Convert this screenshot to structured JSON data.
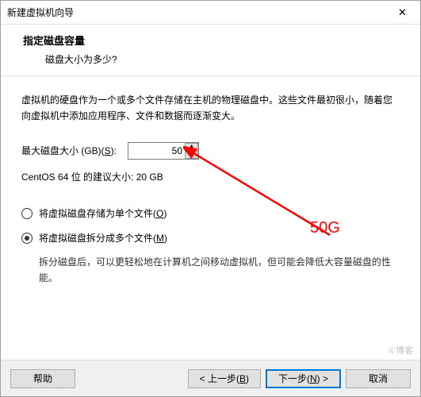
{
  "window": {
    "title": "新建虚拟机向导"
  },
  "header": {
    "title": "指定磁盘容量",
    "subtitle": "磁盘大小为多少?"
  },
  "content": {
    "description": "虚拟机的硬盘作为一个或多个文件存储在主机的物理磁盘中。这些文件最初很小，随着您向虚拟机中添加应用程序、文件和数据而逐渐变大。",
    "maxDisk": {
      "label_prefix": "最大磁盘大小 (GB)(",
      "accel": "S",
      "label_suffix": "):",
      "value": "50"
    },
    "recommendation": "CentOS 64 位 的建议大小: 20 GB",
    "option_single": {
      "prefix": "将虚拟磁盘存储为单个文件(",
      "accel": "O",
      "suffix": ")"
    },
    "option_split": {
      "prefix": "将虚拟磁盘拆分成多个文件(",
      "accel": "M",
      "suffix": ")"
    },
    "split_desc": "拆分磁盘后，可以更轻松地在计算机之间移动虚拟机，但可能会降低大容量磁盘的性能。"
  },
  "footer": {
    "help": "帮助",
    "back_prefix": "< 上一步(",
    "back_accel": "B",
    "back_suffix": ")",
    "next_prefix": "下一步(",
    "next_accel": "N",
    "next_suffix": ") >",
    "cancel": "取消"
  },
  "annotation": {
    "text": "50G"
  },
  "watermark": "©博客"
}
